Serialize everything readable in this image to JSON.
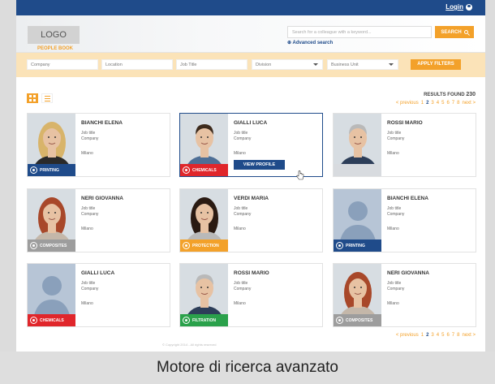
{
  "topbar": {
    "login_label": "Login"
  },
  "header": {
    "logo_text": "LOGO",
    "subbrand": "PEOPLE BOOK",
    "search_placeholder": "Search for a colleague with a keyword...",
    "search_button": "SEARCH",
    "advanced_search": "Advanced search"
  },
  "filters": {
    "company": "Company",
    "location": "Location",
    "job_title": "Job Title",
    "division": "Division",
    "business_unit": "Business Unit",
    "apply": "APPLY FILTERS"
  },
  "results": {
    "label": "RESULTS FOUND",
    "count": "230"
  },
  "pager": {
    "prev": "< previous",
    "pages": [
      "1",
      "2",
      "3",
      "4",
      "5",
      "6",
      "7",
      "8"
    ],
    "current": "2",
    "next": "next >"
  },
  "view_profile_label": "VIEW PROFILE",
  "people": [
    {
      "name": "BIANCHI ELENA",
      "job": "Job title",
      "company": "Company",
      "city": "Milano",
      "division": "PRINTING",
      "color": "#1f4b8a",
      "photo": "woman-blonde"
    },
    {
      "name": "GIALLI LUCA",
      "job": "Job title",
      "company": "Company",
      "city": "Milano",
      "division": "CHEMICALS",
      "color": "#e0262b",
      "photo": "man-smile"
    },
    {
      "name": "ROSSI MARIO",
      "job": "Job title",
      "company": "Company",
      "city": "Milano",
      "division": "",
      "color": "#d8dbdf",
      "photo": "man-senior"
    },
    {
      "name": "NERI GIOVANNA",
      "job": "Job title",
      "company": "Company",
      "city": "Milano",
      "division": "COMPOSITES",
      "color": "#9d9d9d",
      "photo": "woman-red"
    },
    {
      "name": "VERDI MARIA",
      "job": "Job title",
      "company": "Company",
      "city": "Milano",
      "division": "PROTECTION",
      "color": "#f3a12a",
      "photo": "woman-dark"
    },
    {
      "name": "BIANCHI ELENA",
      "job": "Job title",
      "company": "Company",
      "city": "Milano",
      "division": "PRINTING",
      "color": "#1f4b8a",
      "photo": "silhouette"
    },
    {
      "name": "GIALLI LUCA",
      "job": "Job title",
      "company": "Company",
      "city": "Milano",
      "division": "CHEMICALS",
      "color": "#e0262b",
      "photo": "silhouette"
    },
    {
      "name": "ROSSI MARIO",
      "job": "Job title",
      "company": "Company",
      "city": "Milano",
      "division": "FILTRATION",
      "color": "#2aa14b",
      "photo": "man-senior"
    },
    {
      "name": "NERI GIOVANNA",
      "job": "Job title",
      "company": "Company",
      "city": "Milano",
      "division": "COMPOSITES",
      "color": "#9d9d9d",
      "photo": "woman-red"
    }
  ],
  "footer": {
    "copyright": "© Copyright 2014 - All rights reserved"
  },
  "caption": "Motore di ricerca avanzato"
}
